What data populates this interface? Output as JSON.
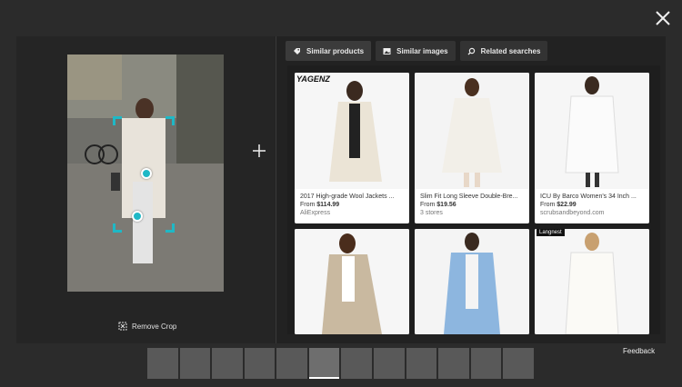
{
  "tabs": [
    {
      "label": "Similar products",
      "icon": "tag-icon",
      "active": true
    },
    {
      "label": "Similar images",
      "icon": "image-icon",
      "active": false
    },
    {
      "label": "Related searches",
      "icon": "search-icon",
      "active": false
    }
  ],
  "left": {
    "remove_crop_label": "Remove Crop"
  },
  "products": [
    {
      "title": "2017 High-grade Wool Jackets ...",
      "price_prefix": "From ",
      "price": "$114.99",
      "source": "AliExpress",
      "brand": "YAGENZ"
    },
    {
      "title": "Slim Fit Long Sleeve Double-Bre...",
      "price_prefix": "From ",
      "price": "$19.56",
      "source": "3 stores"
    },
    {
      "title": "ICU By Barco Women's 34 Inch ...",
      "price_prefix": "From ",
      "price": "$22.99",
      "source": "scrubsandbeyond.com"
    },
    {
      "title": "",
      "price_prefix": "",
      "price": "",
      "source": ""
    },
    {
      "title": "",
      "price_prefix": "",
      "price": "",
      "source": ""
    },
    {
      "title": "",
      "price_prefix": "",
      "price": "",
      "source": "",
      "tag": "Langnest"
    }
  ],
  "feedback_label": "Feedback",
  "colors": {
    "accent": "#1fb8c6",
    "background": "#2b2b2b"
  }
}
